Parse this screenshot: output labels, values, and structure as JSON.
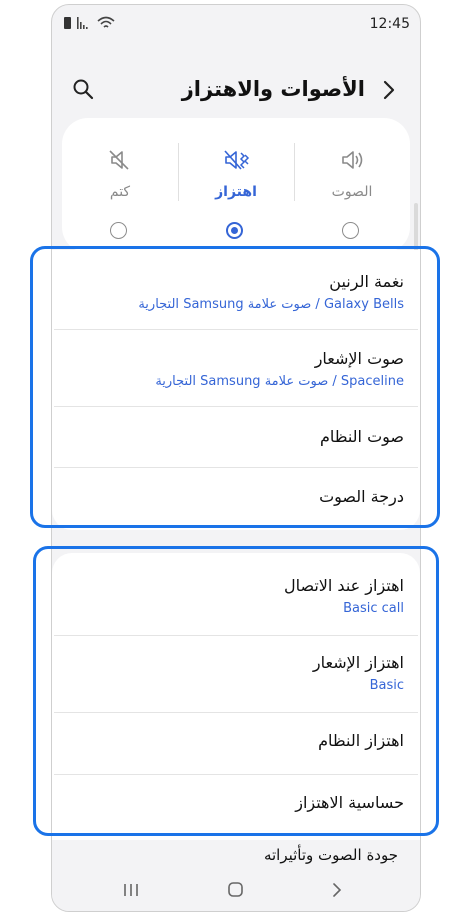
{
  "status_bar": {
    "time": "12:45"
  },
  "header": {
    "title": "الأصوات والاهتزاز"
  },
  "modes": [
    {
      "label": "الصوت",
      "icon": "speaker-icon",
      "selected": false
    },
    {
      "label": "اهتزاز",
      "icon": "vibrate-icon",
      "selected": true
    },
    {
      "label": "كتم",
      "icon": "mute-icon",
      "selected": false
    }
  ],
  "sound_group": [
    {
      "title": "نغمة الرنين",
      "subtitle": "Galaxy Bells / صوت علامة Samsung التجارية"
    },
    {
      "title": "صوت الإشعار",
      "subtitle": "Spaceline / صوت علامة Samsung التجارية"
    },
    {
      "title": "صوت النظام",
      "subtitle": ""
    },
    {
      "title": "درجة الصوت",
      "subtitle": ""
    }
  ],
  "vibration_group": [
    {
      "title": "اهتزاز عند الاتصال",
      "subtitle": "Basic call"
    },
    {
      "title": "اهتزاز الإشعار",
      "subtitle": "Basic"
    },
    {
      "title": "اهتزاز النظام",
      "subtitle": ""
    },
    {
      "title": "حساسية الاهتزاز",
      "subtitle": ""
    }
  ],
  "bottom_item": {
    "title": "جودة الصوت وتأثيراته"
  },
  "colors": {
    "accent": "#3565d6",
    "highlight_frame": "#1a73e8",
    "background": "#f3f3f5"
  }
}
